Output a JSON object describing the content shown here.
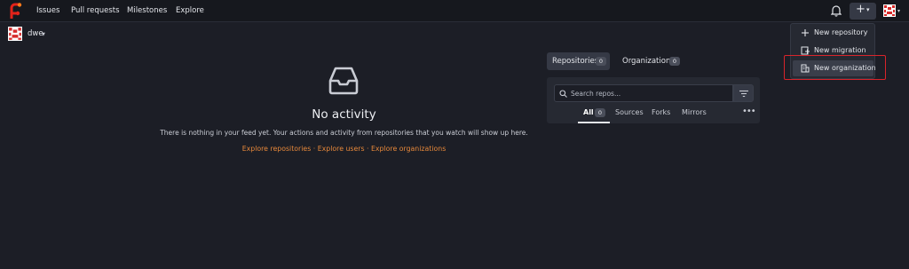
{
  "nav": {
    "links": [
      "Issues",
      "Pull requests",
      "Milestones",
      "Explore"
    ]
  },
  "context": {
    "user": "dwe"
  },
  "feed": {
    "title": "No activity",
    "description": "There is nothing in your feed yet. Your actions and activity from repositories that you watch will show up here.",
    "explore_repos": "Explore repositories",
    "explore_users": "Explore users",
    "explore_orgs": "Explore organizations",
    "separator": "·"
  },
  "panel": {
    "tabs": [
      {
        "label": "Repositories",
        "count": "0"
      },
      {
        "label": "Organizations",
        "count": "0"
      }
    ],
    "search_placeholder": "Search repos...",
    "subtabs": [
      {
        "label": "All",
        "count": "0"
      },
      {
        "label": "Sources"
      },
      {
        "label": "Forks"
      },
      {
        "label": "Mirrors"
      }
    ],
    "more": "•••"
  },
  "dropdown": {
    "items": [
      "New repository",
      "New migration",
      "New organization"
    ]
  },
  "colors": {
    "background": "#1c1e26",
    "navbar": "#16181e",
    "accent_link": "#e7883a",
    "highlight": "#d8242b"
  }
}
